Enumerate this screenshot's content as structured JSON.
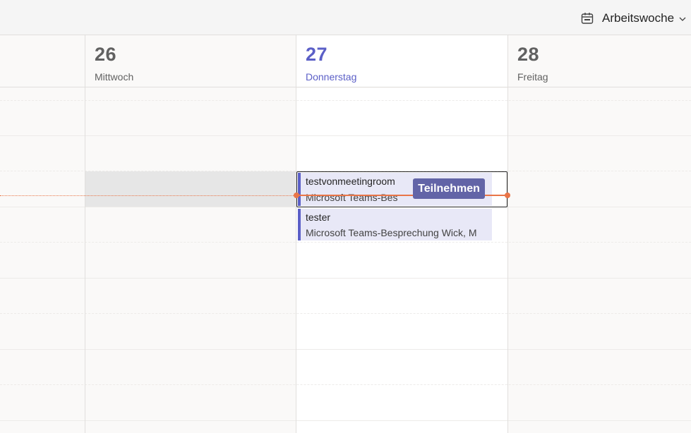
{
  "toolbar": {
    "view_icon": "calendar-icon",
    "view_label": "Arbeitswoche",
    "view_chevron": "chevron-down-icon"
  },
  "days": [
    {
      "number": "26",
      "name": "Mittwoch",
      "today": false
    },
    {
      "number": "27",
      "name": "Donnerstag",
      "today": true
    },
    {
      "number": "28",
      "name": "Freitag",
      "today": false
    }
  ],
  "events": [
    {
      "title": "testvonmeetingroom",
      "subtitle": "Microsoft Teams-Bes",
      "join_label": "Teilnehmen"
    },
    {
      "title": "tester",
      "subtitle": "Microsoft Teams-Besprechung  Wick, M"
    }
  ],
  "colors": {
    "accent": "#5b5fc7",
    "join_button": "#6264a7",
    "event_bg": "#e8e8f7",
    "now_indicator": "#e97548"
  }
}
